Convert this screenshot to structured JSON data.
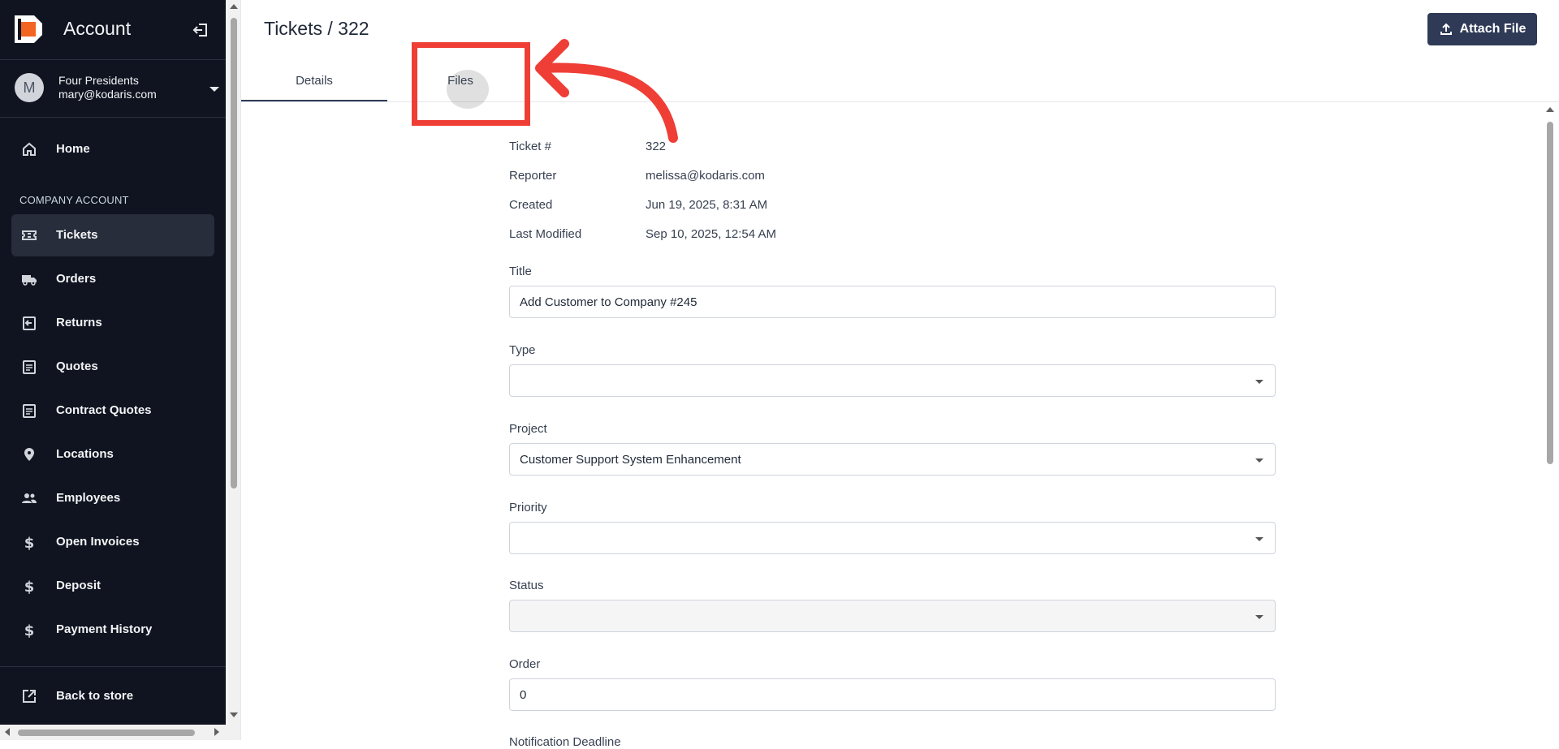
{
  "sidebar": {
    "title": "Account",
    "user": {
      "initial": "M",
      "name": "Four Presidents",
      "email": "mary@kodaris.com"
    },
    "items_top": [
      {
        "label": "Home",
        "icon": "home-icon"
      }
    ],
    "section_label": "COMPANY ACCOUNT",
    "items": [
      {
        "label": "Tickets",
        "icon": "ticket-icon",
        "active": true
      },
      {
        "label": "Orders",
        "icon": "truck-icon"
      },
      {
        "label": "Returns",
        "icon": "return-icon"
      },
      {
        "label": "Quotes",
        "icon": "clipboard-icon"
      },
      {
        "label": "Contract Quotes",
        "icon": "clipboard-icon"
      },
      {
        "label": "Locations",
        "icon": "location-pin-icon"
      },
      {
        "label": "Employees",
        "icon": "people-icon"
      },
      {
        "label": "Open Invoices",
        "icon": "dollar-icon"
      },
      {
        "label": "Deposit",
        "icon": "dollar-icon"
      },
      {
        "label": "Payment History",
        "icon": "dollar-icon"
      }
    ],
    "footer_item": {
      "label": "Back to store",
      "icon": "external-link-icon"
    }
  },
  "header": {
    "title": "Tickets / 322",
    "attach_label": "Attach File"
  },
  "tabs": [
    {
      "label": "Details",
      "active": true
    },
    {
      "label": "Files",
      "active": false
    }
  ],
  "ticket": {
    "meta": [
      {
        "key": "Ticket #",
        "value": "322"
      },
      {
        "key": "Reporter",
        "value": "melissa@kodaris.com"
      },
      {
        "key": "Created",
        "value": "Jun 19, 2025, 8:31 AM"
      },
      {
        "key": "Last Modified",
        "value": "Sep 10, 2025, 12:54 AM"
      }
    ],
    "fields": {
      "title": {
        "label": "Title",
        "value": "Add Customer to Company #245"
      },
      "type": {
        "label": "Type",
        "value": ""
      },
      "project": {
        "label": "Project",
        "value": "Customer Support System Enhancement"
      },
      "priority": {
        "label": "Priority",
        "value": ""
      },
      "status": {
        "label": "Status",
        "value": ""
      },
      "order": {
        "label": "Order",
        "value": "0"
      },
      "next_label": "Notification Deadline"
    }
  },
  "colors": {
    "sidebar_bg": "#0f1420",
    "accent": "#2f3a56",
    "annotation": "#ef3e36"
  }
}
